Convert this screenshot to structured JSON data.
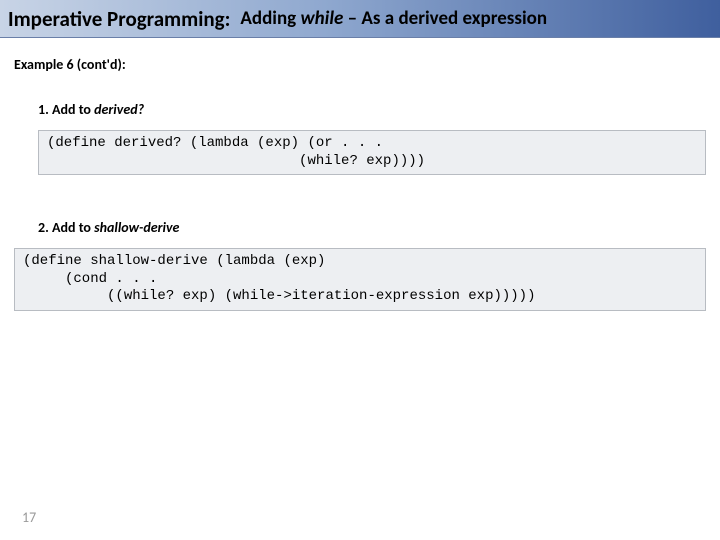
{
  "title": {
    "left": "Imperative Programming:",
    "right_prefix": "Adding ",
    "right_italic": "while",
    "right_suffix": " – As a derived expression"
  },
  "example_label": "Example 6 (cont'd):",
  "steps": [
    {
      "num": "1.",
      "verb": "Add to ",
      "target": "derived?"
    },
    {
      "num": "2.",
      "verb": "Add to ",
      "target": "shallow-derive"
    }
  ],
  "code": {
    "block1": "(define derived? (lambda (exp) (or . . .\n                              (while? exp))))",
    "block2": "(define shallow-derive (lambda (exp)\n     (cond . . .\n          ((while? exp) (while->iteration-expression exp)))))"
  },
  "page_number": "17"
}
